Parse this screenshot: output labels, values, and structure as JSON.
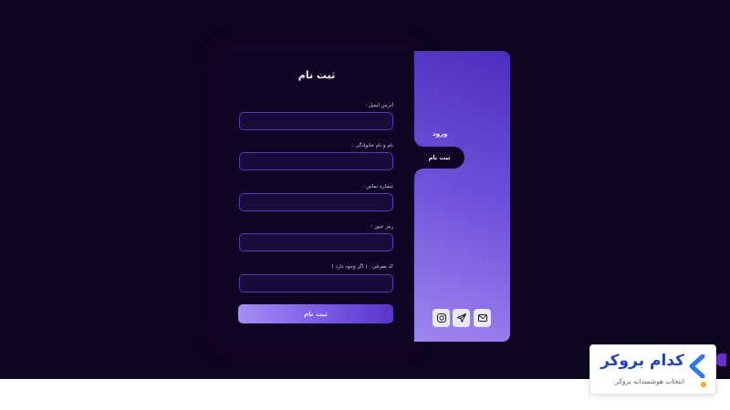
{
  "form": {
    "title": "ثبت نام",
    "fields": [
      {
        "label": "آدرس ایمیل :",
        "value": ""
      },
      {
        "label": "نام و نام خانوادگی :",
        "value": ""
      },
      {
        "label": "شماره تماس :",
        "value": ""
      },
      {
        "label": "رمز عبور :",
        "value": ""
      },
      {
        "label": "کد معرفی : ( اگر وجود دارد )",
        "value": ""
      }
    ],
    "submit_label": "ثبت نام"
  },
  "side_panel": {
    "tabs": [
      {
        "label": "ورود",
        "active": false
      },
      {
        "label": "ثبت نام",
        "active": true
      }
    ],
    "social_icons": [
      "instagram-icon",
      "telegram-icon",
      "mail-icon"
    ]
  },
  "watermark": {
    "brand": "کدام بروکر",
    "tagline": "انتخاب هوشمندانه بروکر"
  },
  "colors": {
    "background": "#10051f",
    "card": "#0f0625",
    "accent": "#6f52da",
    "input_border": "#5a37b7",
    "brand_blue": "#2343b4",
    "brand_orange": "#f5a623"
  }
}
